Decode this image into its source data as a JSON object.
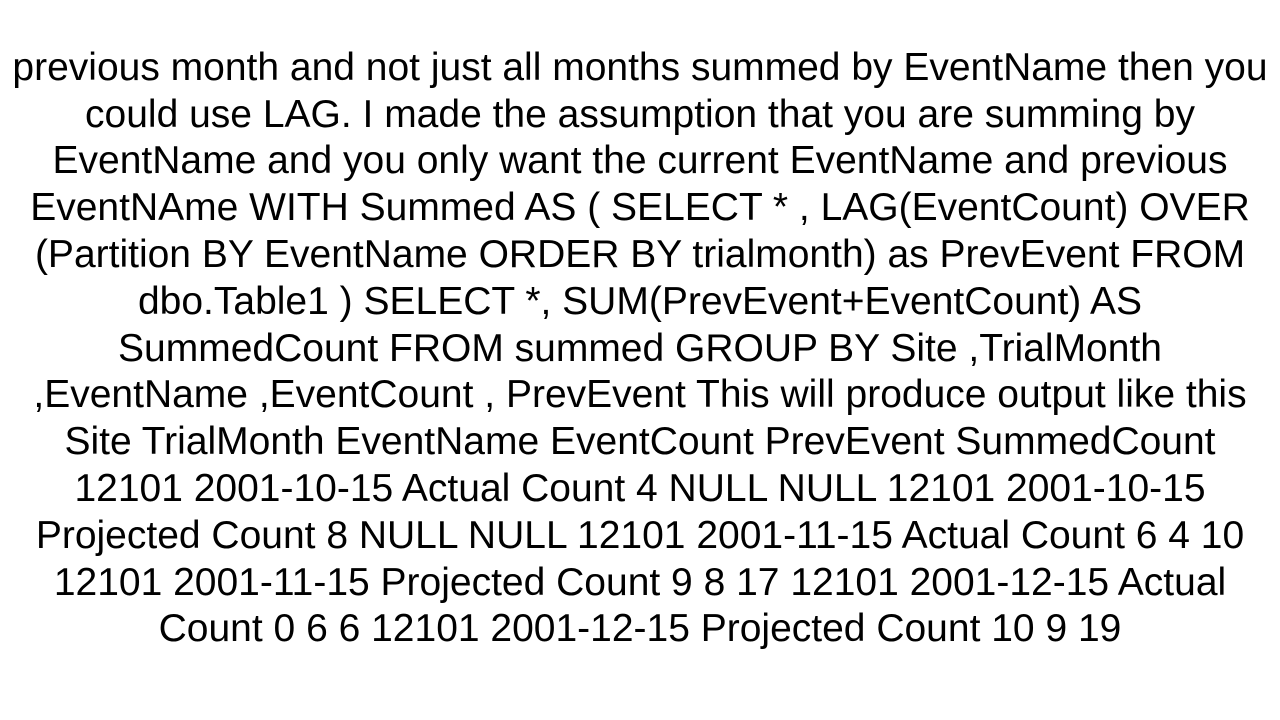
{
  "body": "previous month and not just all months summed by EventName then you could use LAG. I made the assumption that you are summing by EventName and you only want the current EventName and previous EventNAme WITH Summed AS ( SELECT * , LAG(EventCount) OVER (Partition BY EventName ORDER BY trialmonth) as PrevEvent FROM dbo.Table1   )      SELECT *, SUM(PrevEvent+EventCount) AS SummedCount       FROM summed    GROUP BY   Site           ,TrialMonth           ,EventName           ,EventCount           , PrevEvent  This will produce output like this Site    TrialMonth  EventName   EventCount  PrevEvent   SummedCount 12101   2001-10-15  Actual Count    4   NULL    NULL 12101   2001-10-15  Projected Count 8   NULL    NULL 12101   2001-11-15  Actual Count    6   4   10 12101   2001-11-15  Projected Count 9   8   17 12101   2001-12-15  Actual Count    0   6   6 12101   2001-12-15  Projected Count 10  9   19"
}
